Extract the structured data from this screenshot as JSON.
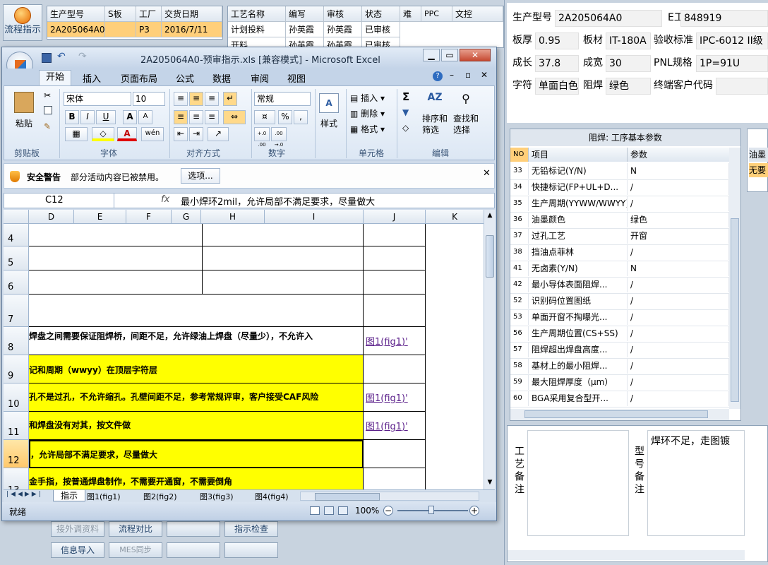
{
  "left_app": {
    "flow_button": "流程指示",
    "grid1": {
      "headers": [
        "生产型号",
        "S板",
        "工厂",
        "交货日期"
      ],
      "row": [
        "2A205064A0",
        "",
        "P3",
        "2016/7/11"
      ]
    },
    "grid2": {
      "headers": [
        "工艺名称",
        "编写",
        "审核",
        "状态",
        "难",
        "PPC",
        "文控"
      ],
      "rows": [
        [
          "计划投料",
          "孙英霞",
          "孙英霞",
          "已审核",
          "",
          "",
          ""
        ],
        [
          "开料",
          "孙英霞",
          "孙英霞",
          "已审核",
          "",
          "",
          ""
        ]
      ]
    },
    "bottom_buttons": [
      "接外调资料",
      "流程对比",
      "",
      "指示检查",
      "信息导入",
      "MES同步",
      "",
      ""
    ]
  },
  "excel": {
    "title": "2A205064A0-预审指示.xls  [兼容模式] - Microsoft Excel",
    "tabs": [
      "开始",
      "插入",
      "页面布局",
      "公式",
      "数据",
      "审阅",
      "视图"
    ],
    "clipboard": {
      "paste": "粘贴",
      "group": "剪贴板"
    },
    "font": {
      "name": "宋体",
      "size": "10",
      "group": "字体",
      "bold": "B",
      "italic": "I",
      "underline": "U",
      "grow": "A",
      "shrink": "A",
      "font_color": "A",
      "phonetic": "wén"
    },
    "align": {
      "group": "对齐方式"
    },
    "number": {
      "format": "常规",
      "group": "数字",
      "percent": "%",
      "comma": ",",
      "inc": "+.0 .00",
      "dec": ".00 →.0"
    },
    "style": {
      "label": "样式"
    },
    "cells": {
      "insert": "插入",
      "delete": "删除",
      "format": "格式",
      "group": "单元格"
    },
    "edit": {
      "sum": "Σ",
      "sort": "排序和\n筛选",
      "find": "查找和\n选择",
      "group": "编辑"
    },
    "security": {
      "title": "安全警告",
      "text": "部分活动内容已被禁用。",
      "options": "选项..."
    },
    "name_box": "C12",
    "fx": "fx",
    "formula": "最小焊环2mil，允许局部不满足要求，尽量做大",
    "columns": [
      "D",
      "E",
      "F",
      "G",
      "H",
      "I",
      "J",
      "K"
    ],
    "rows": [
      {
        "num": "4",
        "text": "",
        "link": "",
        "yellow": false
      },
      {
        "num": "5",
        "text": "",
        "link": "",
        "yellow": false
      },
      {
        "num": "6",
        "text": "",
        "link": "",
        "yellow": false
      },
      {
        "num": "7",
        "text": "",
        "link": "",
        "yellow": false
      },
      {
        "num": "8",
        "text": "焊盘之间需要保证阻焊桥，间距不足，允许绿油上焊盘（尽量少），不允许入",
        "link": "图1(fig1)'",
        "yellow": false
      },
      {
        "num": "9",
        "text": "记和周期（wwyy）在顶层字符层",
        "link": "",
        "yellow": true
      },
      {
        "num": "10",
        "text": "孔不是过孔，不允许缩孔。孔壁间距不足，参考常规评审，客户接受CAF风险",
        "link": "图1(fig1)'",
        "yellow": true
      },
      {
        "num": "11",
        "text": "和焊盘没有对其，按文件做",
        "link": "图1(fig1)'",
        "yellow": true
      },
      {
        "num": "12",
        "text": "，允许局部不满足要求，尽量做大",
        "link": "",
        "yellow": true
      },
      {
        "num": "13",
        "text": "金手指，按普通焊盘制作，不需要开通窗，不需要倒角",
        "link": "",
        "yellow": true
      }
    ],
    "sheet_tabs": [
      "指示",
      "图1(fig1)",
      "图2(fig2)",
      "图3(fig3)",
      "图4(fig4)"
    ],
    "status": "就绪",
    "zoom": "100%"
  },
  "right_panel": {
    "fields": [
      {
        "label": "生产型号",
        "value": "2A205064A0"
      },
      {
        "label": "E工号",
        "value": "848919"
      },
      {
        "label": "板厚",
        "value": "0.95"
      },
      {
        "label": "板材",
        "value": "IT-180A"
      },
      {
        "label": "验收标准",
        "value": "IPC-6012 II级"
      },
      {
        "label": "成长",
        "value": "37.8"
      },
      {
        "label": "成宽",
        "value": "30"
      },
      {
        "label": "PNL规格",
        "value": "1P=91U"
      },
      {
        "label": "字符",
        "value": "单面白色"
      },
      {
        "label": "阻焊",
        "value": "绿色"
      },
      {
        "label": "终端客户代码",
        "value": ""
      }
    ],
    "params_title": "阻焊: 工序基本参数",
    "params_headers": [
      "NO",
      "项目",
      "参数"
    ],
    "params": [
      [
        "33",
        "无铅标记(Y/N)",
        "N"
      ],
      [
        "34",
        "快捷标记(FP+UL+D...",
        "/"
      ],
      [
        "35",
        "生产周期(YYWW/WWYY)",
        "/"
      ],
      [
        "36",
        "油墨颜色",
        "绿色"
      ],
      [
        "37",
        "过孔工艺",
        "开窗"
      ],
      [
        "38",
        "挡油点菲林",
        "/"
      ],
      [
        "41",
        "无卤素(Y/N)",
        "N"
      ],
      [
        "42",
        "最小导体表面阻焊...",
        "/"
      ],
      [
        "52",
        "识别码位置图纸",
        "/"
      ],
      [
        "53",
        "单面开窗不掏曝光...",
        "/"
      ],
      [
        "56",
        "生产周期位置(CS+SS)",
        "/"
      ],
      [
        "57",
        "阻焊超出焊盘高度...",
        "/"
      ],
      [
        "58",
        "基材上的最小阻焊...",
        "/"
      ],
      [
        "59",
        "最大阻焊厚度（μm）",
        "/"
      ],
      [
        "60",
        "BGA采用复合型开...",
        "/"
      ]
    ],
    "side_labels": [
      "油墨",
      "无要"
    ],
    "process_remark_label": "工艺备注",
    "model_remark_label": "型号备注",
    "model_remark_text": "焊环不足，走图镀"
  }
}
